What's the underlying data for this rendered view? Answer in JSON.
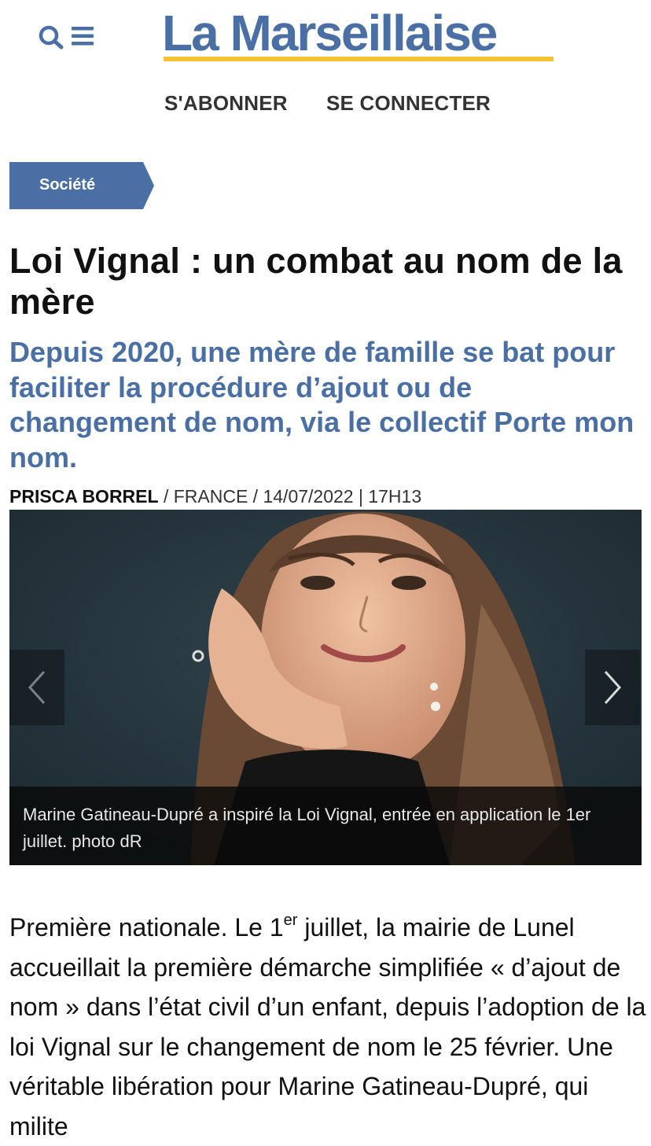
{
  "header": {
    "logo": "La Marseillaise",
    "search_icon": "search-icon",
    "menu_icon": "hamburger-menu-icon",
    "subscribe_label": "S'ABONNER",
    "login_label": "SE CONNECTER"
  },
  "article": {
    "category": "Société",
    "title": "Loi Vignal : un combat au nom de la mère",
    "subtitle": "Depuis 2020, une mère de famille se bat pour faciliter la procédure d’ajout ou de changement de nom, via le collectif Porte mon nom.",
    "byline": {
      "author": "PRISCA BORREL",
      "sep1": " / ",
      "region": "FRANCE",
      "sep2": " / ",
      "date": "14/07/2022 | 17H13"
    },
    "photo": {
      "caption": "Marine Gatineau-Dupré a inspiré la Loi Vignal, entrée en application le 1er juillet. photo dR",
      "prev_icon": "chevron-left-icon",
      "next_icon": "chevron-right-icon"
    },
    "body": {
      "before_sup": "Première nationale. Le 1",
      "sup": "er",
      "after_sup": " juillet, la mairie de Lunel accueillait la première démarche simplifiée « d’ajout de nom » dans l’état civil d’un enfant, depuis l’adoption de la loi Vignal sur le changement de nom le 25 février. Une véritable libération pour Marine Gatineau-Dupré, qui milite"
    }
  },
  "colors": {
    "brand_blue": "#4a6fa5",
    "brand_yellow": "#f2c230"
  }
}
